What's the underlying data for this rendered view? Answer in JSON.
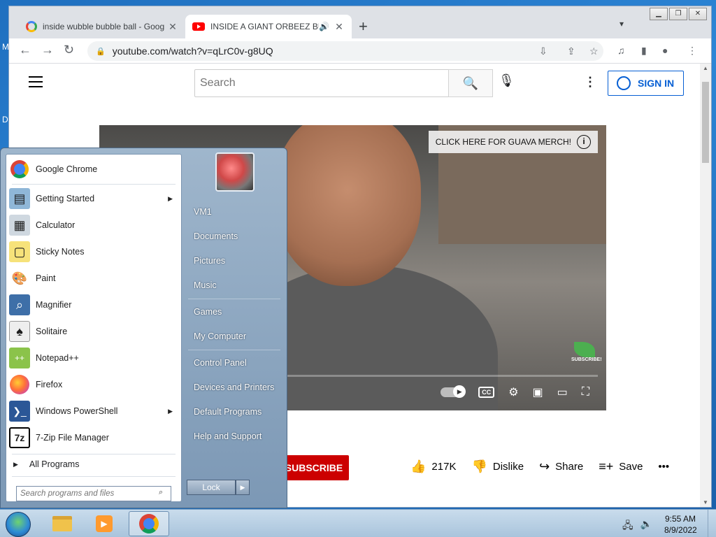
{
  "desktop": {
    "edge_letters": [
      "M",
      "D"
    ]
  },
  "browser": {
    "tabs": [
      {
        "title": "inside wubble bubble ball - Goog",
        "active": false
      },
      {
        "title": "INSIDE A GIANT ORBEEZ BU",
        "active": true
      }
    ],
    "new_tab_glyph": "+",
    "url": "youtube.com/watch?v=qLrC0v-g8UQ",
    "window_controls": [
      "minimize-icon",
      "restore-icon",
      "close-icon"
    ]
  },
  "youtube": {
    "search_placeholder": "Search",
    "sign_in_label": "SIGN IN",
    "video": {
      "merch_banner": "CLICK HERE FOR GUAVA MERCH!",
      "merch_info": "i",
      "subscribe_watermark": "SUBSCRIBE!",
      "cc_label": "CC"
    },
    "subscribe_label": "SUBSCRIBE",
    "actions": {
      "likes": "217K",
      "dislike": "Dislike",
      "share": "Share",
      "save": "Save",
      "more": "•••"
    }
  },
  "start_menu": {
    "programs": [
      {
        "name": "Google Chrome",
        "icon": "chrome-icon",
        "submenu": false
      },
      {
        "name": "Getting Started",
        "icon": "getting-started-icon",
        "submenu": true
      },
      {
        "name": "Calculator",
        "icon": "calculator-icon",
        "submenu": false
      },
      {
        "name": "Sticky Notes",
        "icon": "sticky-notes-icon",
        "submenu": false
      },
      {
        "name": "Paint",
        "icon": "paint-icon",
        "submenu": false
      },
      {
        "name": "Magnifier",
        "icon": "magnifier-icon",
        "submenu": false
      },
      {
        "name": "Solitaire",
        "icon": "solitaire-icon",
        "submenu": false
      },
      {
        "name": "Notepad++",
        "icon": "notepad-plus-plus-icon",
        "submenu": false
      },
      {
        "name": "Firefox",
        "icon": "firefox-icon",
        "submenu": false
      },
      {
        "name": "Windows PowerShell",
        "icon": "powershell-icon",
        "submenu": true
      },
      {
        "name": "7-Zip File Manager",
        "icon": "seven-zip-icon",
        "submenu": false
      }
    ],
    "all_programs": "All Programs",
    "search_placeholder": "Search programs and files",
    "right_links": [
      "VM1",
      "Documents",
      "Pictures",
      "Music",
      "Games",
      "My Computer",
      "Control Panel",
      "Devices and Printers",
      "Default Programs",
      "Help and Support"
    ],
    "lock_label": "Lock"
  },
  "taskbar": {
    "time": "9:55 AM",
    "date": "8/9/2022"
  }
}
